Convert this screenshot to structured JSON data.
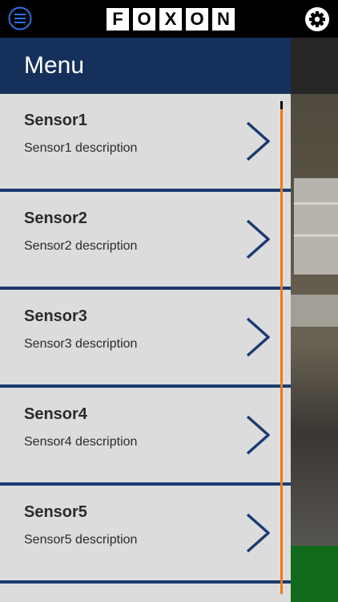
{
  "topbar": {
    "logo_letters": [
      "F",
      "O",
      "X",
      "O",
      "N"
    ],
    "menu_icon": "hamburger-circle-icon",
    "settings_icon": "gear-icon"
  },
  "drawer": {
    "title": "Menu",
    "items": [
      {
        "name": "Sensor1",
        "description": "Sensor1 description",
        "icon": "chevron-right-icon"
      },
      {
        "name": "Sensor2",
        "description": "Sensor2 description",
        "icon": "chevron-right-icon"
      },
      {
        "name": "Sensor3",
        "description": "Sensor3 description",
        "icon": "chevron-right-icon"
      },
      {
        "name": "Sensor4",
        "description": "Sensor4 description",
        "icon": "chevron-right-icon"
      },
      {
        "name": "Sensor5",
        "description": "Sensor5 description",
        "icon": "chevron-right-icon"
      }
    ]
  },
  "colors": {
    "header_bg": "#15315b",
    "divider": "#1c3a70",
    "item_bg": "#dcdcdc",
    "scrollbar": "#ee7a16",
    "chevron": "#1c3a70"
  }
}
